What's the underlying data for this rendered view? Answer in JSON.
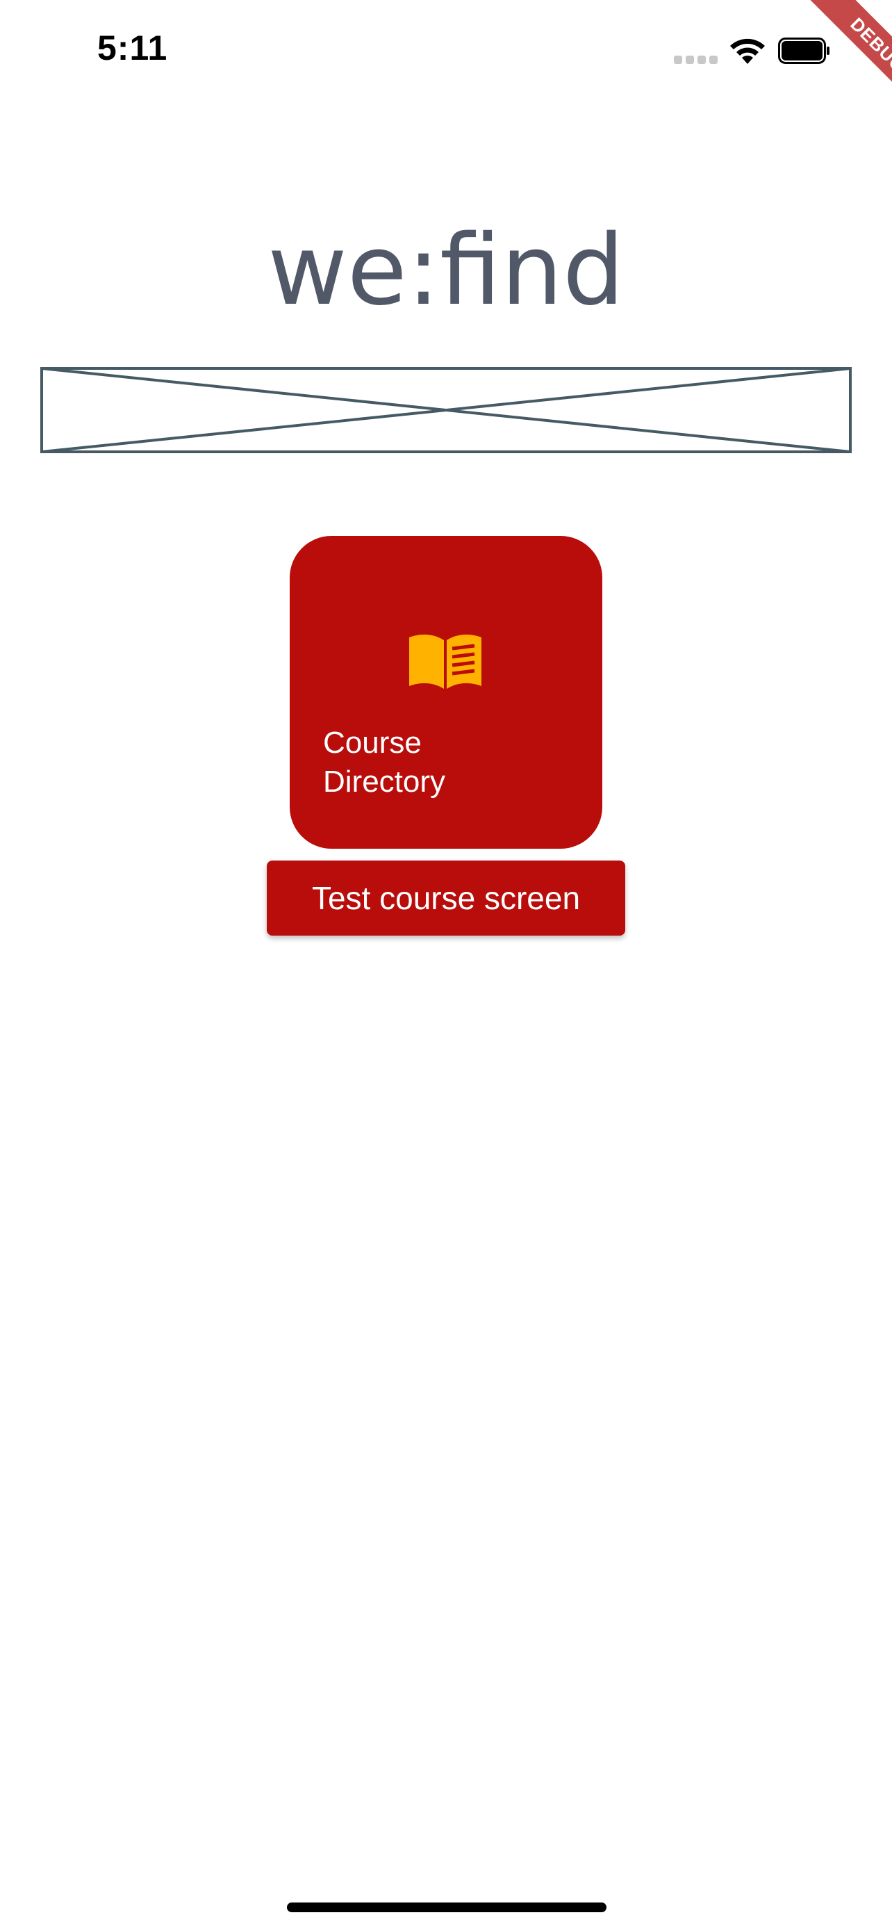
{
  "status_bar": {
    "time": "5:11"
  },
  "debug_banner": {
    "label": "DEBUG",
    "color": "#b71c1c"
  },
  "header": {
    "title": "we:find",
    "title_color": "#515868"
  },
  "placeholder_image": {
    "icon": "image-placeholder-icon",
    "stroke_color": "#455a64"
  },
  "course_card": {
    "label_line1": "Course",
    "label_line2": "Directory",
    "icon": "book-icon",
    "icon_color": "#ffb300",
    "background": "#b80d0a"
  },
  "test_button": {
    "label": "Test course screen",
    "background": "#b80d0a"
  }
}
